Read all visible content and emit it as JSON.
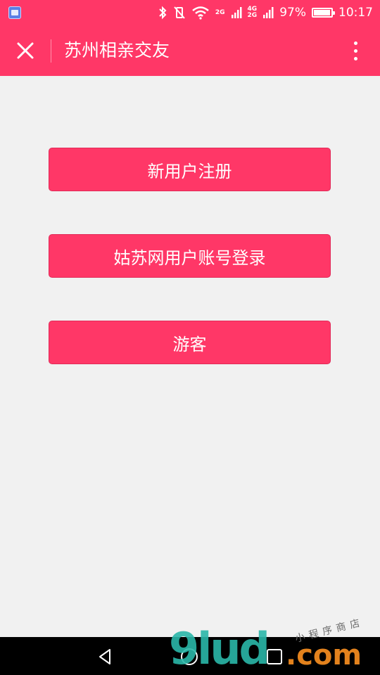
{
  "status_bar": {
    "network_top": "2G",
    "network_mid": "4G",
    "network_bottom": "2G",
    "battery_percent": "97%",
    "battery_level": 0.97,
    "time": "10:17",
    "icons": [
      "gallery-app-icon",
      "bluetooth-icon",
      "vibrate-icon",
      "wifi-icon",
      "signal-icon",
      "battery-icon"
    ]
  },
  "header": {
    "title": "苏州相亲交友",
    "close_icon": "close-icon",
    "more_icon": "more-vertical-icon",
    "background": "#ff3767"
  },
  "actions": [
    {
      "label": "新用户注册"
    },
    {
      "label": "姑苏网用户账号登录"
    },
    {
      "label": "游客"
    }
  ],
  "nav_bar": {
    "icons": [
      "back-icon",
      "home-icon",
      "recent-apps-icon"
    ]
  },
  "watermark": {
    "logo": "9lud",
    "suffix": ".com",
    "sub": "小程序商店"
  },
  "colors": {
    "accent": "#ff3767",
    "page_bg": "#f1f1f1",
    "nav_bg": "#000000"
  }
}
